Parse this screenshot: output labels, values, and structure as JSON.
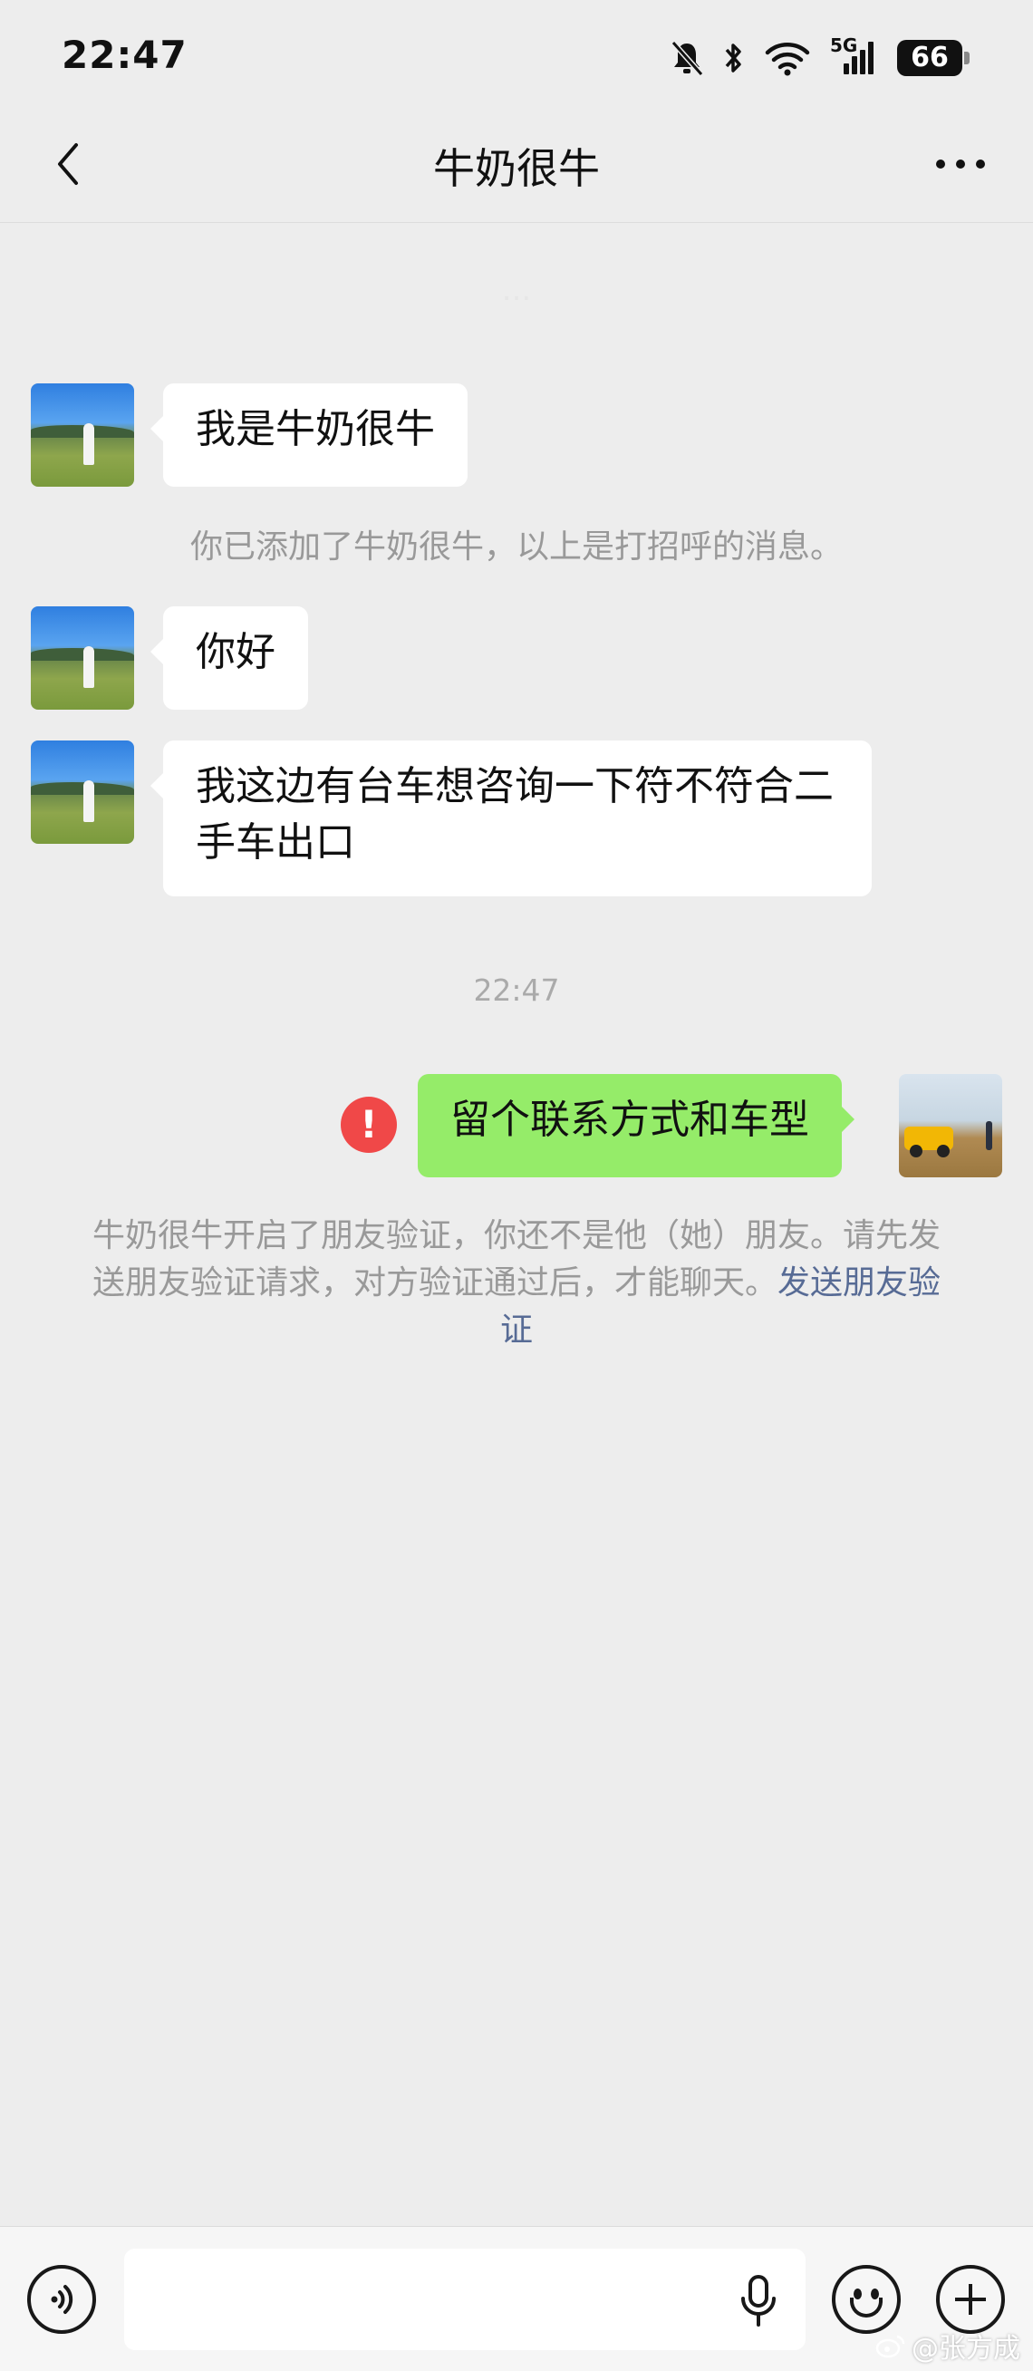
{
  "status_bar": {
    "time": "22:47",
    "network": "5G",
    "battery": "66",
    "icons": [
      "bell-muted-icon",
      "bluetooth-icon",
      "wifi-icon",
      "signal-icon",
      "battery-icon"
    ]
  },
  "header": {
    "title": "牛奶很牛",
    "back_icon": "chevron-left-icon",
    "more_icon": "more-dots-icon"
  },
  "chat": {
    "faded_time": "...",
    "messages": [
      {
        "from": "contact",
        "text": "我是牛奶很牛"
      },
      {
        "type": "system",
        "text": "你已添加了牛奶很牛，以上是打招呼的消息。"
      },
      {
        "from": "contact",
        "text": "你好"
      },
      {
        "from": "contact",
        "text": "我这边有台车想咨询一下符不符合二手车出口"
      },
      {
        "type": "time",
        "text": "22:47"
      },
      {
        "from": "me",
        "text": "留个联系方式和车型",
        "status": "failed"
      }
    ],
    "verification_notice": {
      "text": "牛奶很牛开启了朋友验证，你还不是他（她）朋友。请先发送朋友验证请求，对方验证通过后，才能聊天。",
      "link": "发送朋友验证"
    }
  },
  "input_bar": {
    "icons": [
      "voice-icon",
      "mic-icon",
      "emoji-icon",
      "plus-icon"
    ],
    "text": ""
  },
  "watermark": "@张方成",
  "colors": {
    "background": "#ededed",
    "my_bubble": "#95ec69",
    "contact_bubble": "#ffffff",
    "error": "#f04848",
    "link": "#576b95"
  }
}
